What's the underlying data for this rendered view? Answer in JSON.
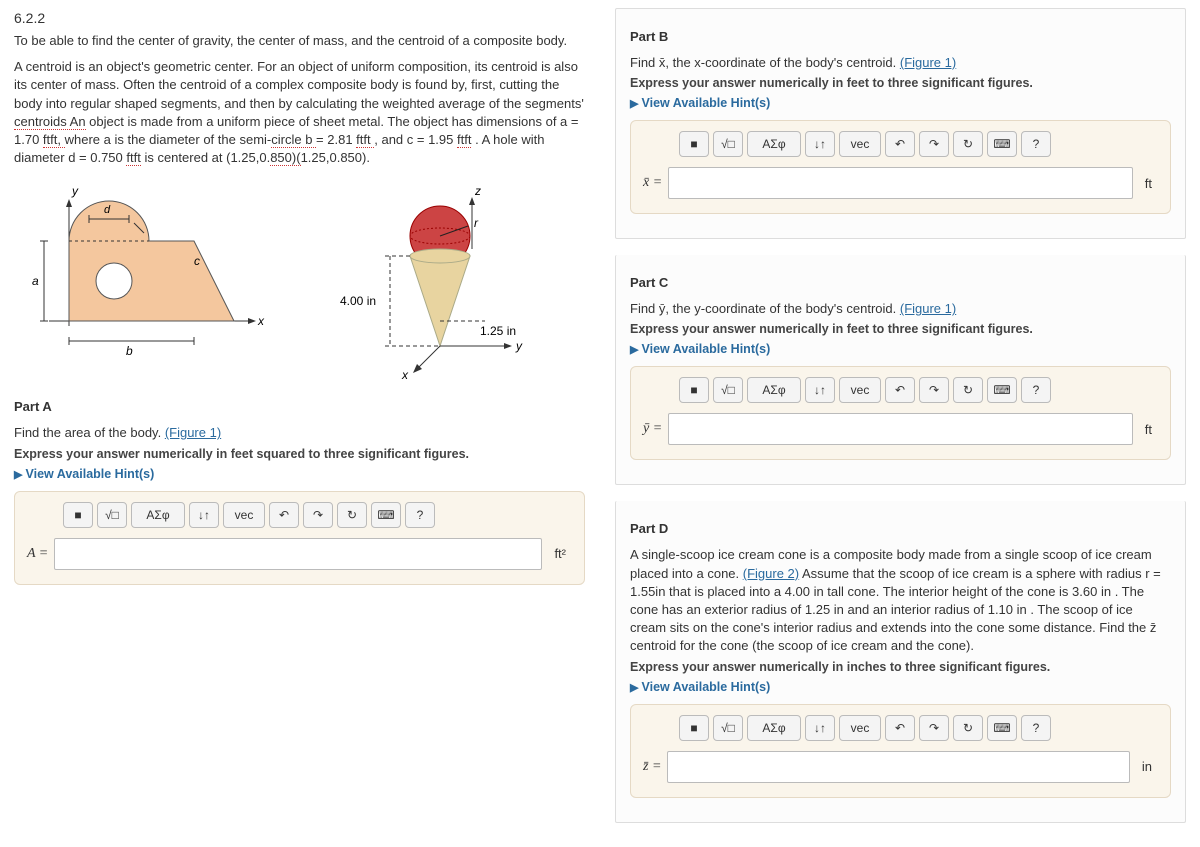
{
  "sectionNumber": "6.2.2",
  "intro1": "To be able to find the center of gravity, the center of mass, and the centroid of a composite body.",
  "intro2a": "A centroid is an object's geometric center. For an object of uniform composition, its centroid is also its center of mass. Often the centroid of a complex composite body is found by, first, cutting the body into regular shaped segments, and then by calculating the weighted average of the segments' ",
  "intro2b_dotted": "centroids An",
  "intro2c": " object is made from a uniform piece of sheet metal. The object has dimensions of a = 1.70 ",
  "intro2d_dotted": "ftft, ",
  "intro2e": "where a is the diameter of the semi-",
  "intro2f_dotted": "circle b ",
  "intro2g": "= 2.81 ",
  "intro2h_dotted": "ftft ",
  "intro2i": ", and c = 1.95 ",
  "intro2j_dotted": "ftft",
  "intro2k": " . A hole with diameter d = 0.750 ",
  "intro2l_dotted": "ftft",
  "intro2m": " is centered at (1.25,0.",
  "intro2n_dotted": "850)(",
  "intro2o": "1.25,0.850).",
  "fig_labels": {
    "y": "y",
    "x": "x",
    "d": "d",
    "a": "a",
    "c": "c",
    "b": "b",
    "z": "z",
    "r": "r",
    "h": "4.00 in",
    "w": "1.25 in",
    "y2": "y",
    "x2": "x"
  },
  "partA": {
    "title": "Part A",
    "prompt": "Find the area of the body. ",
    "figLink": "(Figure 1)",
    "instruction": "Express your answer numerically in feet squared to three significant figures.",
    "hints": "View Available Hint(s)",
    "varLabel": "A =",
    "unit": "ft²"
  },
  "partB": {
    "title": "Part B",
    "prompt": "Find x̄, the x-coordinate of the body's centroid. ",
    "figLink": "(Figure 1)",
    "instruction": "Express your answer numerically in feet to three significant figures.",
    "hints": "View Available Hint(s)",
    "varLabel": "x̄ =",
    "unit": "ft"
  },
  "partC": {
    "title": "Part C",
    "prompt": "Find ȳ, the y-coordinate of the body's centroid. ",
    "figLink": "(Figure 1)",
    "instruction": "Express your answer numerically in feet to three significant figures.",
    "hints": "View Available Hint(s)",
    "varLabel": "ȳ =",
    "unit": "ft"
  },
  "partD": {
    "title": "Part D",
    "prompt1": "A single-scoop ice cream cone is a composite body made from a single scoop of ice cream placed into a cone. ",
    "figLink": "(Figure 2)",
    "prompt2": " Assume that the scoop of ice cream is a sphere with radius r = 1.55in that is placed into a 4.00 in tall cone. The interior height of the cone is 3.60 in . The cone has an exterior radius of 1.25 in and an interior radius of 1.10 in . The scoop of ice cream sits on the cone's interior radius and extends into the cone some distance. Find the z̄ centroid for the cone (the scoop of ice cream and the cone).",
    "instruction": "Express your answer numerically in inches to three significant figures.",
    "hints": "View Available Hint(s)",
    "varLabel": "z̄ =",
    "unit": "in"
  },
  "toolbar": {
    "b1": "■",
    "b2": "√□",
    "b3": "ΑΣφ",
    "b4": "↓↑",
    "b5": "vec",
    "b6": "↶",
    "b7": "↷",
    "b8": "↻",
    "b9": "⌨",
    "b10": "?"
  }
}
